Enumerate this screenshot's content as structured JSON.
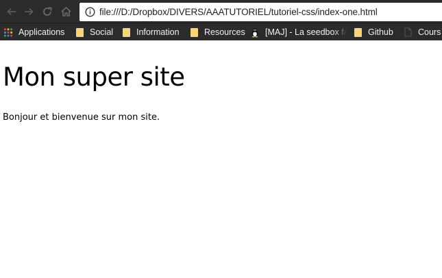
{
  "browser": {
    "address_bar": {
      "url": "file:///D:/Dropbox/DIVERS/AAATUTORIEL/tutoriel-css/index-one.html"
    },
    "bookmarks": [
      {
        "label": "Applications",
        "icon": "apps-grid-icon"
      },
      {
        "label": "Social",
        "icon": "folder-icon"
      },
      {
        "label": "Information",
        "icon": "folder-icon"
      },
      {
        "label": "Resources",
        "icon": "folder-icon"
      },
      {
        "label": "[MAJ] - La seedbox fa",
        "icon": "penguin-icon"
      },
      {
        "label": "Github",
        "icon": "folder-icon"
      },
      {
        "label": "Cours",
        "icon": "page-icon"
      }
    ],
    "colors": {
      "toolbar_bg": "#2b2b2b",
      "folder": "#f7d774"
    }
  },
  "page": {
    "title": "Mon super site",
    "intro": "Bonjour et bienvenue sur mon site."
  }
}
